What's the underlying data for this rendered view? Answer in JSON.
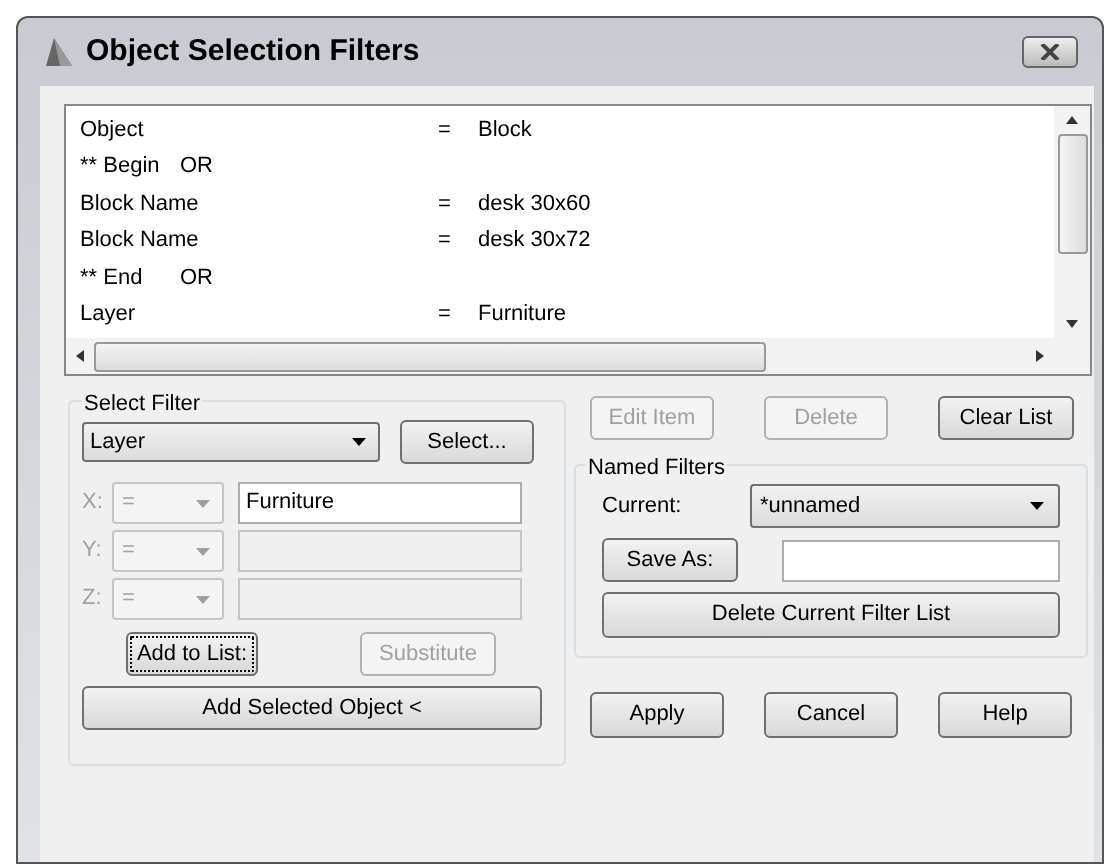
{
  "window": {
    "title": "Object Selection Filters"
  },
  "filter_list": [
    {
      "kind": "condition",
      "name": "Object",
      "operator": "=",
      "value": "Block"
    },
    {
      "kind": "group",
      "name": "** Begin",
      "operator": "OR"
    },
    {
      "kind": "condition",
      "name": "Block Name",
      "operator": "=",
      "value": "desk 30x60"
    },
    {
      "kind": "condition",
      "name": "Block Name",
      "operator": "=",
      "value": "desk 30x72"
    },
    {
      "kind": "group",
      "name": "** End",
      "operator": "OR"
    },
    {
      "kind": "condition",
      "name": "Layer",
      "operator": "=",
      "value": "Furniture"
    }
  ],
  "select_filter": {
    "title": "Select Filter",
    "type": "Layer",
    "select_button": "Select...",
    "coordinates": [
      {
        "label": "X:",
        "operator": "=",
        "value": "Furniture",
        "disabled": false
      },
      {
        "label": "Y:",
        "operator": "=",
        "disabled": true
      },
      {
        "label": "Z:",
        "operator": "=",
        "disabled": true
      }
    ],
    "add_to_list": {
      "label": "Add to List:",
      "disabled": false
    },
    "substitute": {
      "label": "Substitute",
      "disabled": true
    },
    "add_selected": {
      "label": "Add Selected Object <",
      "disabled": false
    }
  },
  "list_buttons": [
    {
      "label": "Edit Item",
      "disabled": true
    },
    {
      "label": "Delete",
      "disabled": true
    },
    {
      "label": "Clear List",
      "disabled": false
    }
  ],
  "named_filters": {
    "title": "Named Filters",
    "current_label": "Current:",
    "current": "*unnamed",
    "save_as": "Save As:",
    "delete_current": "Delete Current Filter List"
  },
  "buttons": [
    "Apply",
    "Cancel",
    "Help"
  ]
}
